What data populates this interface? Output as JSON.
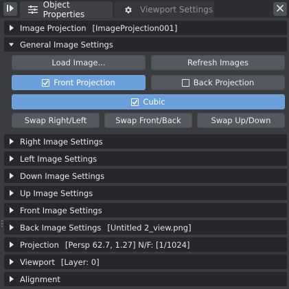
{
  "tabs": [
    {
      "label": "Object Properties",
      "icon": "sliders-icon",
      "active": true
    },
    {
      "label": "Viewport Settings",
      "icon": "gear-icon",
      "active": false
    }
  ],
  "close_icon": "close-icon",
  "pin_icon": "pin-panel-icon",
  "sections": {
    "image_projection": {
      "label": "Image Projection",
      "info": "[ImageProjection001]",
      "expanded": false
    },
    "general": {
      "label": "General Image Settings",
      "expanded": true
    },
    "right": {
      "label": "Right Image Settings",
      "expanded": false
    },
    "left": {
      "label": "Left Image Settings",
      "expanded": false
    },
    "down": {
      "label": "Down Image Settings",
      "expanded": false
    },
    "up": {
      "label": "Up Image Settings",
      "expanded": false
    },
    "front": {
      "label": "Front Image Settings",
      "expanded": false
    },
    "back": {
      "label": "Back Image Settings",
      "info": "[Untitled 2_view.png]",
      "expanded": false
    },
    "projection": {
      "label": "Projection",
      "info": "[Persp 62.7, 1.27] N/F: [1/1024]",
      "expanded": false
    },
    "viewport": {
      "label": "Viewport",
      "info": "[Layer: 0]",
      "expanded": false
    },
    "alignment": {
      "label": "Alignment",
      "expanded": false
    }
  },
  "buttons": {
    "load_image": "Load Image...",
    "refresh_images": "Refresh Images",
    "front_projection": {
      "label": "Front Projection",
      "checked": true
    },
    "back_projection": {
      "label": "Back Projection",
      "checked": false
    },
    "cubic": {
      "label": "Cubic",
      "checked": true
    },
    "swap_right_left": "Swap Right/Left",
    "swap_front_back": "Swap Front/Back",
    "swap_up_down": "Swap Up/Down"
  },
  "colors": {
    "background": "#3a3c40",
    "section_header": "#25272b",
    "button": "#55585e",
    "button_active": "#6b9fdc",
    "text": "#e6e7e9"
  }
}
